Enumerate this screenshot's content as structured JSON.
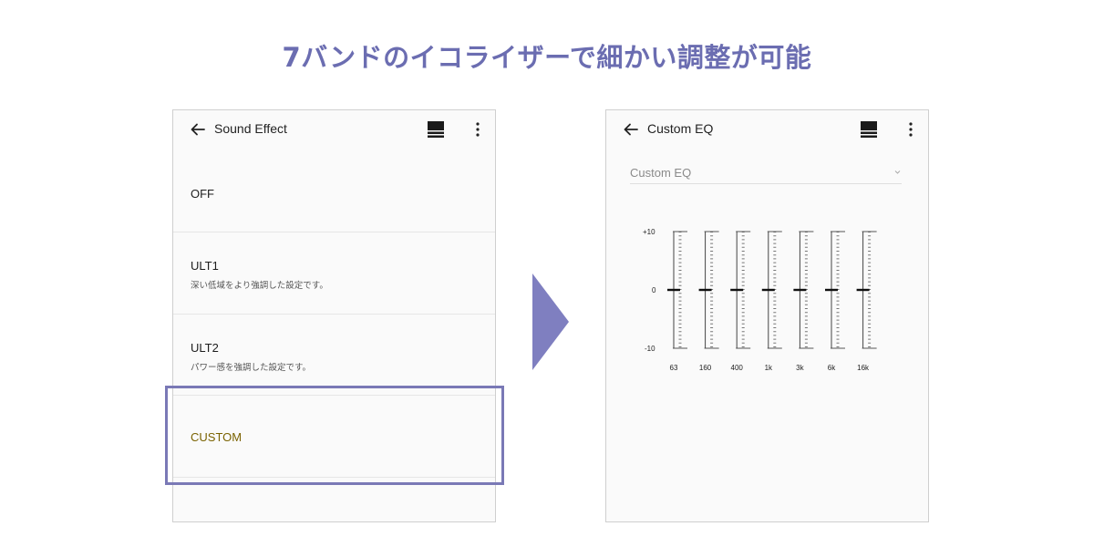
{
  "headline": "7バンドのイコライザーで細かい調整が可能",
  "left_screen": {
    "title": "Sound Effect",
    "items": [
      {
        "label": "OFF",
        "description": ""
      },
      {
        "label": "ULT1",
        "description": "深い低域をより強調した設定です。"
      },
      {
        "label": "ULT2",
        "description": "パワー感を強調した設定です。"
      },
      {
        "label": "CUSTOM",
        "description": ""
      }
    ],
    "selected_index": 3
  },
  "right_screen": {
    "title": "Custom EQ",
    "preset_value": "Custom EQ",
    "scale_labels": {
      "top": "+10",
      "mid": "0",
      "bottom": "-10"
    },
    "bands": [
      {
        "freq": "63",
        "gain": 0
      },
      {
        "freq": "160",
        "gain": 0
      },
      {
        "freq": "400",
        "gain": 0
      },
      {
        "freq": "1k",
        "gain": 0
      },
      {
        "freq": "3k",
        "gain": 0
      },
      {
        "freq": "6k",
        "gain": 0
      },
      {
        "freq": "16k",
        "gain": 0
      }
    ],
    "gain_range": [
      -10,
      10
    ]
  },
  "colors": {
    "headline": "#6b6db1",
    "selection_frame": "#7a79b6",
    "arrow": "#7f7fc0",
    "custom_label": "#7a6200"
  },
  "icons": [
    "back-arrow-icon",
    "layout-icon",
    "more-vert-icon",
    "chevron-down-icon",
    "next-arrow-icon"
  ]
}
